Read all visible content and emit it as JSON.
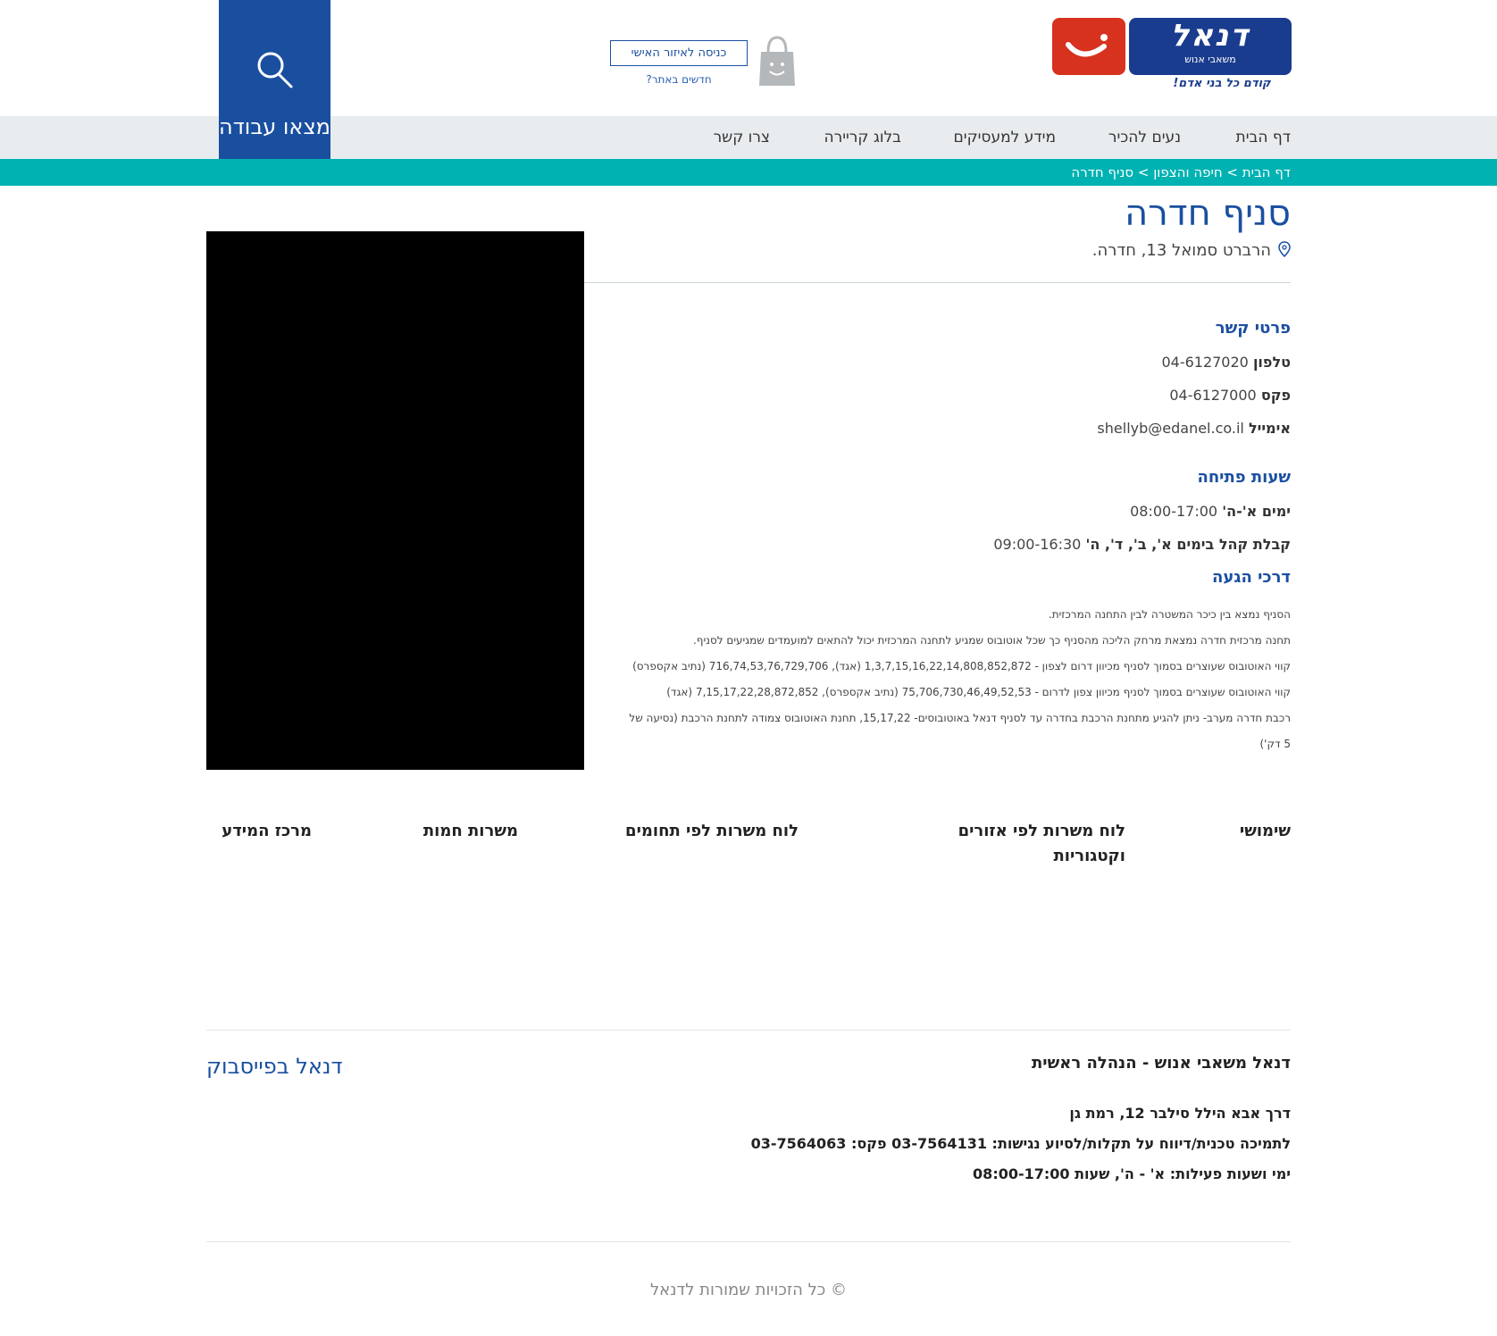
{
  "header": {
    "logo_name": "דנאל",
    "logo_sub": "משאבי אנוש",
    "logo_tagline": "קודם כל בני אדם!",
    "login_label": "כניסה לאיזור האישי",
    "new_link": "חדשים באתר?",
    "find_job_label": "מצאו עבודה"
  },
  "nav": {
    "items": [
      "דף הבית",
      "נעים להכיר",
      "מידע למעסיקים",
      "בלוג קריירה",
      "צרו קשר"
    ]
  },
  "breadcrumb": {
    "items": [
      "דף הבית",
      "חיפה והצפון",
      "סניף חדרה"
    ],
    "separator": " > "
  },
  "branch": {
    "title": "סניף חדרה",
    "address": "הרברט סמואל 13, חדרה."
  },
  "contact": {
    "heading": "פרטי קשר",
    "phone_label": "טלפון",
    "phone": "04-6127020",
    "fax_label": "פקס",
    "fax": "04-6127000",
    "email_label": "אימייל",
    "email": "shellyb@edanel.co.il"
  },
  "hours": {
    "heading": "שעות פתיחה",
    "days_label": "ימים א'-ה'",
    "days_hours": "08:00-17:00",
    "reception_label": "קבלת קהל בימים א', ב', ד', ה'",
    "reception_hours": "09:00-16:30"
  },
  "directions": {
    "heading": "דרכי הגעה",
    "lines": [
      "הסניף נמצא בין כיכר המשטרה לבין התחנה המרכזית.",
      "תחנה מרכזית חדרה נמצאת מרחק הליכה מהסניף כך שכל אוטובוס שמגיע לתחנה המרכזית יכול להתאים למועמדים שמגיעים לסניף.",
      "קווי האוטובוס שעוצרים בסמוך לסניף מכיוון דרום לצפון - 1,3,7,15,16,22,14,808,852,872 (אגד), 716,74,53,76,729,706 (נתיב אקספרס)",
      "קווי האוטובוס שעוצרים בסמוך לסניף מכיוון צפון לדרום - 75,706,730,46,49,52,53 (נתיב אקספרס), 7,15,17,22,28,872,852 (אגד)",
      "רכבת חדרה מערב- ניתן להגיע מתחנת הרכבת בחדרה עד לסניף דנאל באוטובוסים- 15,17,22, תחנת האוטובוס צמודה לתחנת הרכבת (נסיעה של",
      "5 דק')"
    ]
  },
  "footer_links": [
    "שימושי",
    "לוח משרות לפי אזורים וקטגוריות",
    "לוח משרות לפי תחומים",
    "משרות חמות",
    "מרכז המידע"
  ],
  "footer": {
    "heading": "דנאל משאבי אנוש - הנהלה ראשית",
    "facebook": "דנאל בפייסבוק",
    "address": "דרך אבא הילל סילבר 12, רמת גן",
    "support": "לתמיכה טכנית/דיווח על תקלות/לסיוע נגישות: 03-7564131 פקס: 03-7564063",
    "hours": "ימי ושעות פעילות: א' - ה', שעות 08:00-17:00",
    "copyright": "© כל הזכויות שמורות לדנאל"
  },
  "colors": {
    "brand_blue": "#1a4fa0",
    "teal": "#00b2b2",
    "logo_red": "#d7321e",
    "nav_bg": "#e8ecef"
  },
  "icons": [
    "search-icon",
    "shopping-bag-icon",
    "location-pin-icon",
    "smile-logo-icon"
  ]
}
